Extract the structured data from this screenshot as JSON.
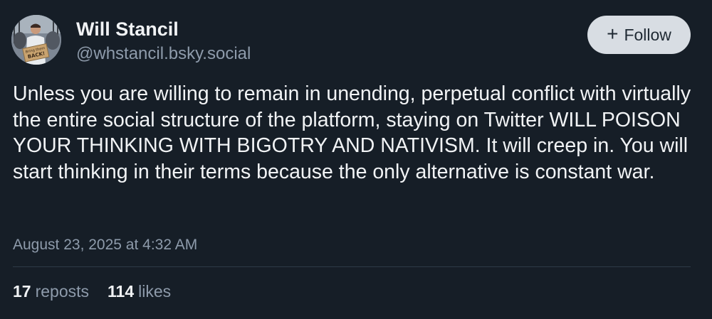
{
  "author": {
    "display_name": "Will Stancil",
    "handle": "@whstancil.bsky.social",
    "avatar_sign_text": "Bring them BACK!"
  },
  "follow_button": {
    "icon": "plus-icon",
    "label": "Follow"
  },
  "post": {
    "text": "Unless you are willing to remain in unending, perpetual conflict with virtually the entire social structure of the platform, staying on Twitter WILL POISON YOUR THINKING WITH BIGOTRY AND NATIVISM. It will creep in. You will start thinking in their terms because the only alternative is constant war.",
    "timestamp": "August 23, 2025 at 4:32 AM"
  },
  "stats": {
    "reposts_count": "17",
    "reposts_label": "reposts",
    "likes_count": "114",
    "likes_label": "likes"
  },
  "colors": {
    "background": "#161e27",
    "text_primary": "#f1f3f5",
    "text_secondary": "#8e9bab",
    "follow_button_bg": "#d8dde3",
    "divider": "#2e3a47"
  }
}
